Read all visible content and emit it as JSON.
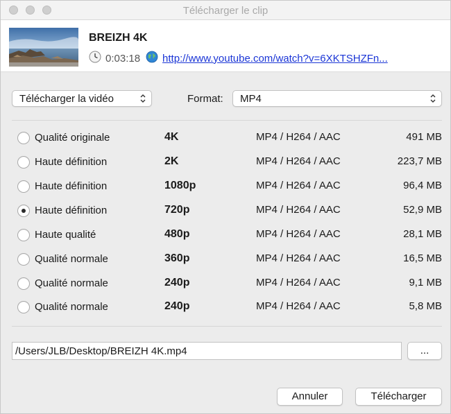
{
  "window": {
    "title": "Télécharger le clip"
  },
  "clip": {
    "title": "BREIZH 4K",
    "duration": "0:03:18",
    "url": "http://www.youtube.com/watch?v=6XKTSHZFn..."
  },
  "controls": {
    "mode_select": "Télécharger la vidéo",
    "format_label": "Format:",
    "format_select": "MP4"
  },
  "qualities": [
    {
      "label": "Qualité originale",
      "resolution": "4K",
      "codec": "MP4 / H264 / AAC",
      "size": "491 MB",
      "selected": false
    },
    {
      "label": "Haute définition",
      "resolution": "2K",
      "codec": "MP4 / H264 / AAC",
      "size": "223,7 MB",
      "selected": false
    },
    {
      "label": "Haute définition",
      "resolution": "1080p",
      "codec": "MP4 / H264 / AAC",
      "size": "96,4 MB",
      "selected": false
    },
    {
      "label": "Haute définition",
      "resolution": "720p",
      "codec": "MP4 / H264 / AAC",
      "size": "52,9 MB",
      "selected": true
    },
    {
      "label": "Haute qualité",
      "resolution": "480p",
      "codec": "MP4 / H264 / AAC",
      "size": "28,1 MB",
      "selected": false
    },
    {
      "label": "Qualité normale",
      "resolution": "360p",
      "codec": "MP4 / H264 / AAC",
      "size": "16,5 MB",
      "selected": false
    },
    {
      "label": "Qualité normale",
      "resolution": "240p",
      "codec": "MP4 / H264 / AAC",
      "size": "9,1 MB",
      "selected": false
    },
    {
      "label": "Qualité normale",
      "resolution": "240p",
      "codec": "MP4 / H264 / AAC",
      "size": "5,8 MB",
      "selected": false
    }
  ],
  "output": {
    "path": "/Users/JLB/Desktop/BREIZH 4K.mp4",
    "browse_label": "..."
  },
  "buttons": {
    "cancel": "Annuler",
    "download": "Télécharger"
  },
  "icons": {
    "clock": "clock-icon",
    "globe": "globe-icon",
    "chevron": "chevron-updown-icon"
  },
  "colors": {
    "link": "#1a35d6"
  }
}
